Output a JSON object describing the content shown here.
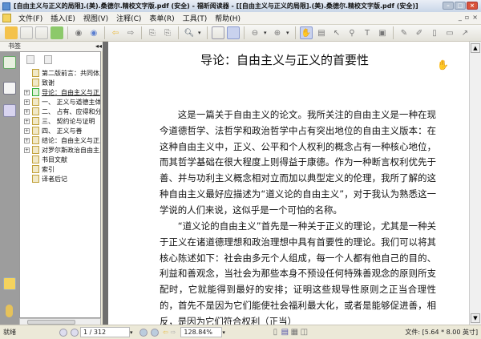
{
  "window": {
    "title": "[自由主义与正义的局限].(美).桑德尔.精校文字版.pdf (安全) - 福昕阅读器 - [[自由主义与正义的局限].(美).桑德尔.精校文字版.pdf (安全)]"
  },
  "menu": [
    "文件(F)",
    "插入(E)",
    "视图(V)",
    "注释(C)",
    "表单(R)",
    "工具(T)",
    "帮助(H)"
  ],
  "sidebar": {
    "header": "书签",
    "bookmarks": [
      {
        "label": "第二版前言：共同体主",
        "expandable": false
      },
      {
        "label": "致谢",
        "expandable": false
      },
      {
        "label": "导论：自由主义与正义",
        "expandable": true,
        "selected": true
      },
      {
        "label": "一、 正义与道德主体",
        "expandable": true
      },
      {
        "label": "二、 占有、应得和分配",
        "expandable": true
      },
      {
        "label": "三、 契约论与证明",
        "expandable": true
      },
      {
        "label": "四、 正义与善",
        "expandable": true
      },
      {
        "label": "结论：自由主义与正义",
        "expandable": true
      },
      {
        "label": "对罗尔斯政治自由主义",
        "expandable": true
      },
      {
        "label": "书目文献",
        "expandable": false
      },
      {
        "label": "索引",
        "expandable": false
      },
      {
        "label": "译者后记",
        "expandable": false
      }
    ]
  },
  "document": {
    "title": "导论：自由主义与正义的首要性",
    "paragraphs": [
      "这是一篇关于自由主义的论文。我所关注的自由主义是一种在现今道德哲学、法哲学和政治哲学中占有突出地位的自由主义版本：在这种自由主义中，正义、公平和个人权利的概念占有一种核心地位，而其哲学基础在很大程度上则得益于康德。作为一种断言权利优先于善、并与功利主义概念相对立而加以典型定义的伦理，我所了解的这种自由主义最好应描述为“道义论的自由主义”，对于我认为熟悉这一学说的人们来说，这似乎是一个可怕的名称。",
      "“道义论的自由主义”首先是一种关于正义的理论，尤其是一种关于正义在诸道德理想和政治理想中具有首要性的理论。我们可以将其核心陈述如下：社会由多元个人组成，每一个人都有他自己的目的、利益和善观念，当社会为那些本身不预设任何特殊善观念的原则所支配时，它就能得到最好的安排；证明这些规导性原则之正当合理性的，首先不是因为它们能使社会福利最大化，或者是能够促进善，相反，是因为它们符合权利（正当）"
    ]
  },
  "status": {
    "ready": "就绪",
    "page": "1 / 312",
    "zoom": "128.84%",
    "file_size": "文件: [5.64 * 8.00 英寸]"
  }
}
